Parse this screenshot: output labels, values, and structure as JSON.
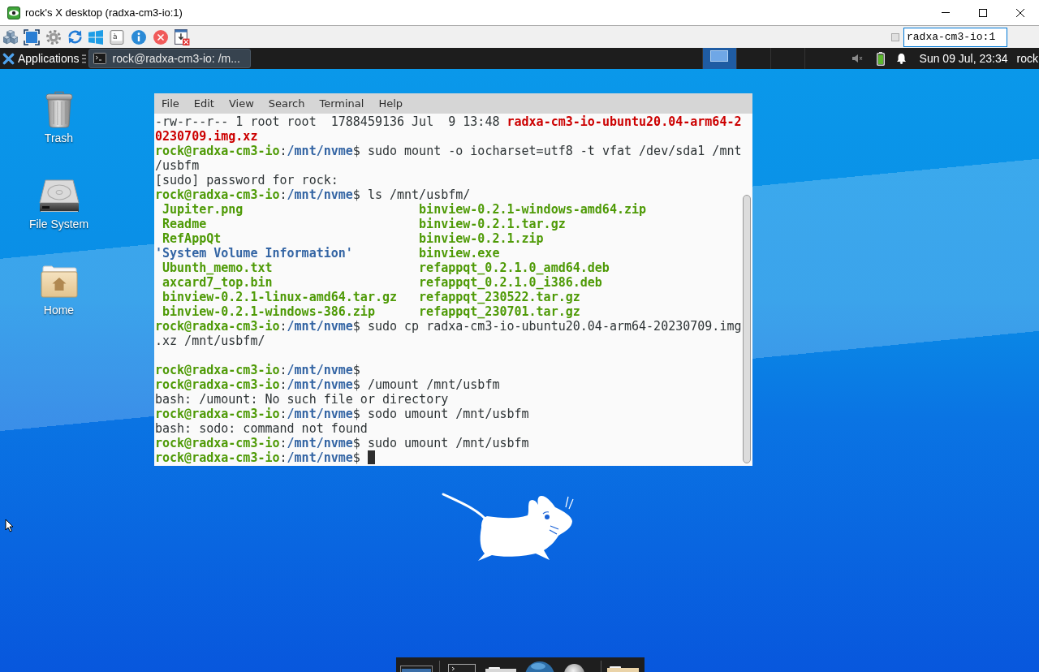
{
  "window": {
    "title": "rock's X desktop (radxa-cm3-io:1)"
  },
  "toolbar": {
    "key_label": "à",
    "host_field": {
      "value": "radxa-cm3-io:1"
    }
  },
  "panel": {
    "menu_label": "Applications",
    "tasks": [
      {
        "label": "rock@radxa-cm3-io: /m...",
        "selected": true
      }
    ],
    "workspaces": [
      {
        "selected": true,
        "window": true
      },
      {
        "selected": false,
        "window": false
      },
      {
        "selected": false,
        "window": false
      },
      {
        "selected": false,
        "window": false
      }
    ],
    "clock": "Sun 09 Jul, 23:34",
    "user": "rock"
  },
  "desktop": {
    "icons": [
      {
        "label": "Trash",
        "kind": "trash"
      },
      {
        "label": "File System",
        "kind": "drive"
      },
      {
        "label": "Home",
        "kind": "home"
      }
    ]
  },
  "terminal": {
    "menu": [
      "File",
      "Edit",
      "View",
      "Search",
      "Terminal",
      "Help"
    ],
    "lines": [
      {
        "kind": "text",
        "segments": [
          {
            "text": "-rw-r--r-- 1 root root  1788459136 Jul  9 13:48 ",
            "kind": "plain"
          },
          {
            "text": "radxa-cm3-io-ubuntu20.04-arm64-2",
            "kind": "archive"
          }
        ]
      },
      {
        "kind": "text",
        "segments": [
          {
            "text": "0230709.img.xz",
            "kind": "archive"
          }
        ]
      },
      {
        "kind": "text",
        "segments": [
          {
            "text": "rock@radxa-cm3-io",
            "kind": "user"
          },
          {
            "text": ":",
            "kind": "plain"
          },
          {
            "text": "/mnt/nvme",
            "kind": "path"
          },
          {
            "text": "$ sudo mount -o iocharset=utf8 -t vfat /dev/sda1 /mnt",
            "kind": "plain"
          }
        ]
      },
      {
        "kind": "text",
        "segments": [
          {
            "text": "/usbfm",
            "kind": "plain"
          }
        ]
      },
      {
        "kind": "text",
        "segments": [
          {
            "text": "[sudo] password for rock:",
            "kind": "plain"
          }
        ]
      },
      {
        "kind": "text",
        "segments": [
          {
            "text": "rock@radxa-cm3-io",
            "kind": "user"
          },
          {
            "text": ":",
            "kind": "plain"
          },
          {
            "text": "/mnt/nvme",
            "kind": "path"
          },
          {
            "text": "$ ls /mnt/usbfm/",
            "kind": "plain"
          }
        ]
      },
      {
        "kind": "listing",
        "entries": [
          {
            "text": " Jupiter.png",
            "kind": "executable"
          },
          {
            "text": "binview-0.2.1-windows-amd64.zip",
            "kind": "executable"
          }
        ]
      },
      {
        "kind": "listing",
        "entries": [
          {
            "text": " Readme",
            "kind": "executable"
          },
          {
            "text": "binview-0.2.1.tar.gz",
            "kind": "executable"
          }
        ]
      },
      {
        "kind": "listing",
        "entries": [
          {
            "text": " RefAppQt",
            "kind": "executable"
          },
          {
            "text": "binview-0.2.1.zip",
            "kind": "executable"
          }
        ]
      },
      {
        "kind": "listing",
        "entries": [
          {
            "text": "'System Volume Information'",
            "kind": "directory"
          },
          {
            "text": "binview.exe",
            "kind": "executable"
          }
        ]
      },
      {
        "kind": "listing",
        "entries": [
          {
            "text": " Ubunth_memo.txt",
            "kind": "executable"
          },
          {
            "text": "refappqt_0.2.1.0_amd64.deb",
            "kind": "executable"
          }
        ]
      },
      {
        "kind": "listing",
        "entries": [
          {
            "text": " axcard7_top.bin",
            "kind": "executable"
          },
          {
            "text": "refappqt_0.2.1.0_i386.deb",
            "kind": "executable"
          }
        ]
      },
      {
        "kind": "listing",
        "entries": [
          {
            "text": " binview-0.2.1-linux-amd64.tar.gz",
            "kind": "executable"
          },
          {
            "text": "refappqt_230522.tar.gz",
            "kind": "executable"
          }
        ]
      },
      {
        "kind": "listing",
        "entries": [
          {
            "text": " binview-0.2.1-windows-386.zip",
            "kind": "executable"
          },
          {
            "text": "refappqt_230701.tar.gz",
            "kind": "executable"
          }
        ]
      },
      {
        "kind": "text",
        "segments": [
          {
            "text": "rock@radxa-cm3-io",
            "kind": "user"
          },
          {
            "text": ":",
            "kind": "plain"
          },
          {
            "text": "/mnt/nvme",
            "kind": "path"
          },
          {
            "text": "$ sudo cp radxa-cm3-io-ubuntu20.04-arm64-20230709.img",
            "kind": "plain"
          }
        ]
      },
      {
        "kind": "text",
        "segments": [
          {
            "text": ".xz /mnt/usbfm/",
            "kind": "plain"
          }
        ]
      },
      {
        "kind": "blank"
      },
      {
        "kind": "text",
        "segments": [
          {
            "text": "rock@radxa-cm3-io",
            "kind": "user"
          },
          {
            "text": ":",
            "kind": "plain"
          },
          {
            "text": "/mnt/nvme",
            "kind": "path"
          },
          {
            "text": "$",
            "kind": "plain"
          }
        ]
      },
      {
        "kind": "text",
        "segments": [
          {
            "text": "rock@radxa-cm3-io",
            "kind": "user"
          },
          {
            "text": ":",
            "kind": "plain"
          },
          {
            "text": "/mnt/nvme",
            "kind": "path"
          },
          {
            "text": "$ /umount /mnt/usbfm",
            "kind": "plain"
          }
        ]
      },
      {
        "kind": "text",
        "segments": [
          {
            "text": "bash: /umount: No such file or directory",
            "kind": "plain"
          }
        ]
      },
      {
        "kind": "text",
        "segments": [
          {
            "text": "rock@radxa-cm3-io",
            "kind": "user"
          },
          {
            "text": ":",
            "kind": "plain"
          },
          {
            "text": "/mnt/nvme",
            "kind": "path"
          },
          {
            "text": "$ sodo umount /mnt/usbfm",
            "kind": "plain"
          }
        ]
      },
      {
        "kind": "text",
        "segments": [
          {
            "text": "bash: sodo: command not found",
            "kind": "plain"
          }
        ]
      },
      {
        "kind": "text",
        "segments": [
          {
            "text": "rock@radxa-cm3-io",
            "kind": "user"
          },
          {
            "text": ":",
            "kind": "plain"
          },
          {
            "text": "/mnt/nvme",
            "kind": "path"
          },
          {
            "text": "$ sudo umount /mnt/usbfm",
            "kind": "plain"
          }
        ]
      },
      {
        "kind": "text",
        "segments": [
          {
            "text": "rock@radxa-cm3-io",
            "kind": "user"
          },
          {
            "text": ":",
            "kind": "plain"
          },
          {
            "text": "/mnt/nvme",
            "kind": "path"
          },
          {
            "text": "$ ",
            "kind": "plain"
          }
        ]
      }
    ],
    "cursor": true
  }
}
